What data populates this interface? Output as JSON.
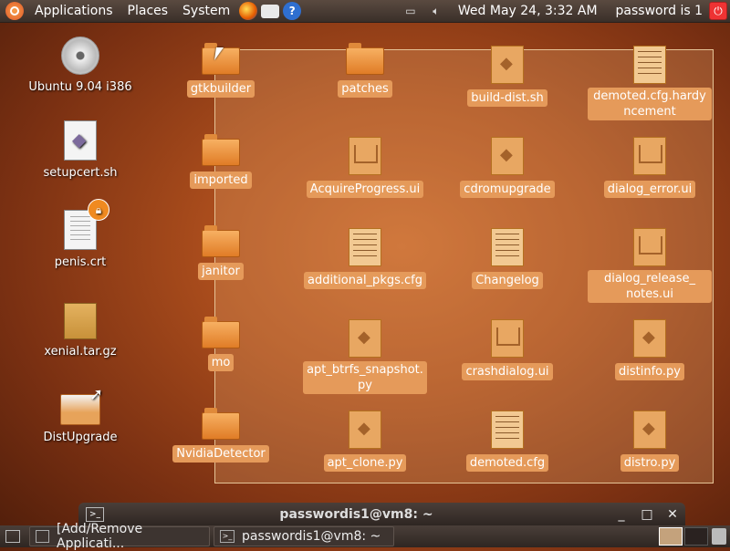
{
  "top_panel": {
    "menus": [
      "Applications",
      "Places",
      "System"
    ],
    "clock": "Wed May 24,  3:32 AM",
    "user_label": "password is 1"
  },
  "desktop_icons": [
    {
      "label": "Ubuntu 9.04 i386",
      "icon": "cd-icon"
    },
    {
      "label": "setupcert.sh",
      "icon": "script-icon"
    },
    {
      "label": "penis.crt",
      "icon": "text-file-icon"
    },
    {
      "label": "xenial.tar.gz",
      "icon": "archive-icon"
    },
    {
      "label": "DistUpgrade",
      "icon": "folder-link-icon"
    }
  ],
  "files": [
    {
      "label": "gtkbuilder",
      "type": "folder"
    },
    {
      "label": "patches",
      "type": "folder"
    },
    {
      "label": "build-dist.sh",
      "type": "script"
    },
    {
      "label": "demoted.cfg.hardy‑ncement",
      "type": "text",
      "preview": "# demacpiadeptanalo"
    },
    {
      "label": "imported",
      "type": "folder"
    },
    {
      "label": "AcquireProgress.ui",
      "type": "image"
    },
    {
      "label": "cdromupgrade",
      "type": "script"
    },
    {
      "label": "dialog_error.ui",
      "type": "image"
    },
    {
      "label": "janitor",
      "type": "folder"
    },
    {
      "label": "additional_pkgs.cfg",
      "type": "text",
      "preview": "builddevsc"
    },
    {
      "label": "Changelog",
      "type": "text",
      "preview": "2007-- aut2007-- fix"
    },
    {
      "label": "dialog_release_notes.ui",
      "type": "image"
    },
    {
      "label": "mo",
      "type": "folder"
    },
    {
      "label": "apt_btrfs_snapshot.py",
      "type": "script"
    },
    {
      "label": "crashdialog.ui",
      "type": "image"
    },
    {
      "label": "distinfo.py",
      "type": "script"
    },
    {
      "label": "NvidiaDetector",
      "type": "folder"
    },
    {
      "label": "apt_clone.py",
      "type": "script"
    },
    {
      "label": "demoted.cfg",
      "type": "text",
      "preview": "# demabi-caccouaccou"
    },
    {
      "label": "distro.py",
      "type": "script"
    }
  ],
  "file_labels": {
    "demoted_hardy_line1": "demoted.cfg.hardy",
    "demoted_hardy_line2": "ncement",
    "dialog_release_line1": "dialog_release_",
    "dialog_release_line2": "notes.ui",
    "apt_btrfs_line1": "apt_btrfs_snapshot.",
    "apt_btrfs_line2": "py"
  },
  "terminal_window": {
    "title": "passwordis1@vm8: ~",
    "controls": [
      "_",
      "□",
      "✕"
    ]
  },
  "bottom_panel": {
    "tasks": [
      {
        "label": "[Add/Remove Applicati..."
      },
      {
        "label": "passwordis1@vm8: ~"
      }
    ]
  }
}
